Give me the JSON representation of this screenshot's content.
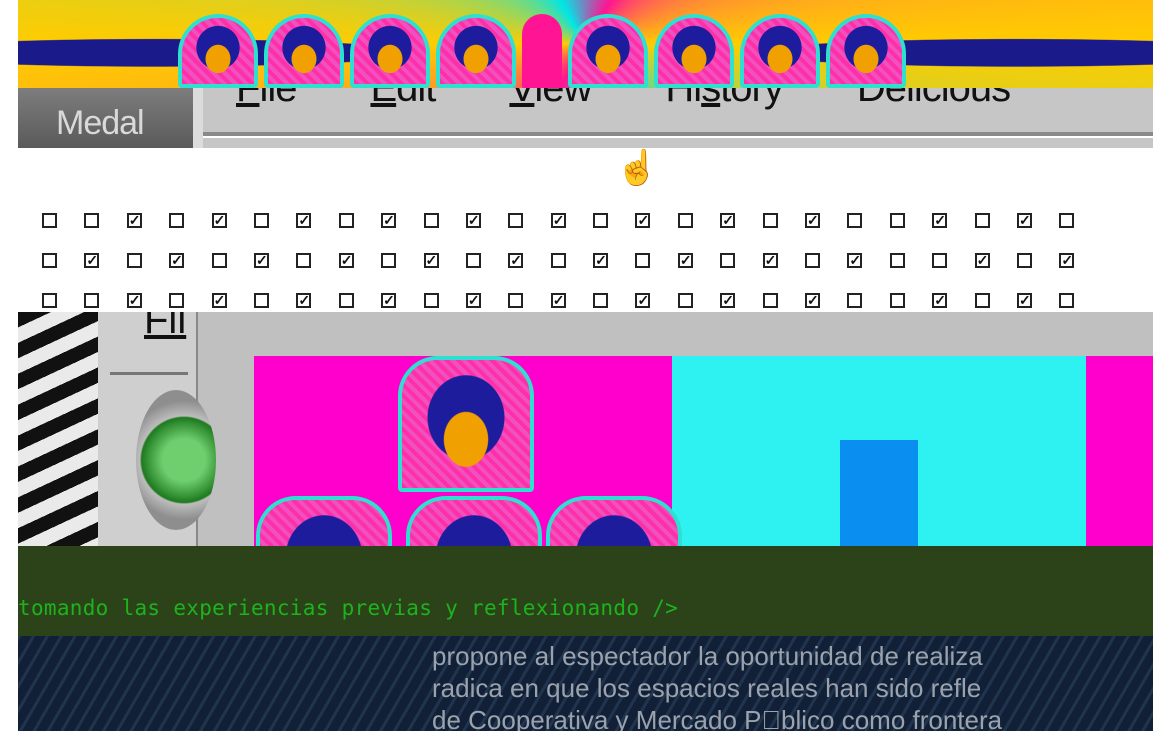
{
  "banner": {
    "face_count": 8
  },
  "menubar": {
    "app_label": "Medal",
    "items": [
      {
        "label": "File",
        "mnemonic": "F"
      },
      {
        "label": "Edit",
        "mnemonic": "E"
      },
      {
        "label": "View",
        "mnemonic": "V"
      },
      {
        "label": "History",
        "mnemonic": "s"
      },
      {
        "label": "Delicious",
        "mnemonic": ""
      }
    ]
  },
  "cursor": {
    "icon": "hand-pointer-icon",
    "glyph": "☝"
  },
  "checkboxes": {
    "rows": [
      [
        0,
        0,
        1,
        0,
        1,
        0,
        1,
        0,
        1,
        0,
        1,
        0,
        1,
        0,
        1,
        0,
        1,
        0,
        1,
        0,
        0,
        1,
        0,
        1,
        0
      ],
      [
        0,
        1,
        0,
        1,
        0,
        1,
        0,
        1,
        0,
        1,
        0,
        1,
        0,
        1,
        0,
        1,
        0,
        1,
        0,
        1,
        0,
        0,
        1,
        0,
        1
      ],
      [
        0,
        0,
        1,
        0,
        1,
        0,
        1,
        0,
        1,
        0,
        1,
        0,
        1,
        0,
        1,
        0,
        1,
        0,
        1,
        0,
        0,
        1,
        0,
        1,
        0
      ]
    ],
    "check_glyph": "✓"
  },
  "window": {
    "menu_fragment": "Fil",
    "button_icon": "green-round-button-icon"
  },
  "terminal": {
    "text": "tomando las experiencias previas y reflexionando />"
  },
  "article": {
    "lines": [
      "propone al espectador la oportunidad de realiza",
      "radica en que los espacios reales han sido refle",
      "de Cooperativa y Mercado P\u0000blico como frontera"
    ]
  },
  "colors": {
    "magenta": "#ff00cc",
    "cyan": "#2ef2f2",
    "blue_block": "#0a8ff0",
    "terminal_green": "#1db31d",
    "terminal_bg": "#2c4319"
  }
}
